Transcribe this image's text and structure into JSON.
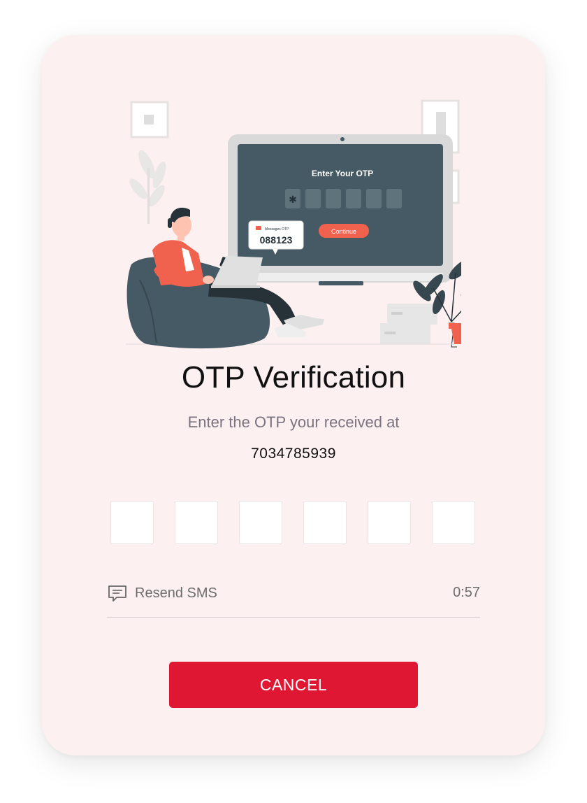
{
  "title": "OTP Verification",
  "subtitle": "Enter the OTP your received at",
  "phone_number": "7034785939",
  "otp": {
    "boxes": [
      "",
      "",
      "",
      "",
      "",
      ""
    ]
  },
  "resend": {
    "label": "Resend SMS",
    "icon": "message-icon"
  },
  "timer": "0:57",
  "cancel_label": "CANCEL",
  "illustration": {
    "screen_title": "Enter Your OTP",
    "screen_first_box": "✱",
    "screen_button": "Continue",
    "bubble_label": "Messages OTP",
    "bubble_code": "088123"
  },
  "colors": {
    "card_background": "#fdf0f0",
    "accent": "#e01733",
    "illustration_accent": "#f0624d",
    "dark_slate": "#455a64"
  }
}
